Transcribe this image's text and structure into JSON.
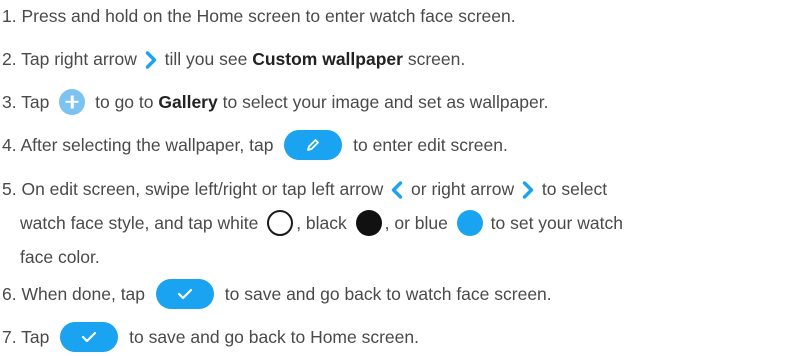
{
  "colors": {
    "text": "#4a4a4a",
    "accent": "#1aa3f0",
    "plus": "#7cc3f2"
  },
  "steps": [
    {
      "a": "1. Press and hold on the Home screen to enter watch face screen."
    },
    {
      "a": "2. Tap right arrow",
      "icon": "chevron-right-icon",
      "b": "till you see",
      "bold": "Custom wallpaper",
      "c": "screen."
    },
    {
      "a": "3. Tap",
      "icon": "plus-icon",
      "b": "to go to",
      "bold": "Gallery",
      "c": "to select your image and set as wallpaper."
    },
    {
      "a": "4. After selecting the wallpaper, tap",
      "icon": "edit-pencil-icon",
      "b": "to enter edit screen."
    },
    {
      "a": "5. On edit screen, swipe left/right or tap left arrow",
      "b": "or right arrow",
      "c": "to select",
      "line2a": "watch face style, and tap white",
      "line2b": ", black",
      "line2c": ", or blue",
      "line2d": "to set your watch",
      "line3": "face color."
    },
    {
      "a": "6. When done, tap",
      "icon": "checkmark-icon",
      "b": "to save and go back to watch face screen."
    },
    {
      "a": "7. Tap",
      "icon": "checkmark-icon",
      "b": "to save and go back to Home screen."
    }
  ]
}
